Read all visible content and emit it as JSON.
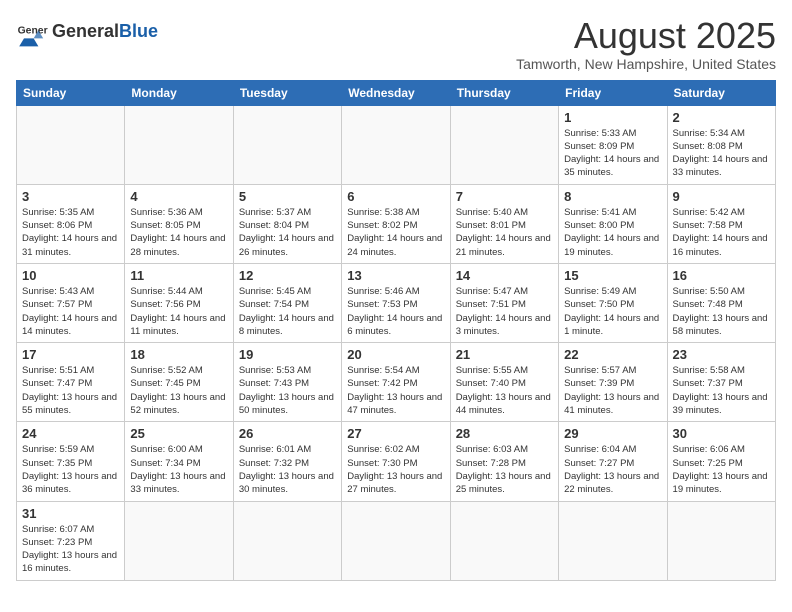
{
  "header": {
    "logo_general": "General",
    "logo_blue": "Blue",
    "month_year": "August 2025",
    "location": "Tamworth, New Hampshire, United States"
  },
  "days_of_week": [
    "Sunday",
    "Monday",
    "Tuesday",
    "Wednesday",
    "Thursday",
    "Friday",
    "Saturday"
  ],
  "weeks": [
    [
      {
        "day": "",
        "info": ""
      },
      {
        "day": "",
        "info": ""
      },
      {
        "day": "",
        "info": ""
      },
      {
        "day": "",
        "info": ""
      },
      {
        "day": "",
        "info": ""
      },
      {
        "day": "1",
        "info": "Sunrise: 5:33 AM\nSunset: 8:09 PM\nDaylight: 14 hours and 35 minutes."
      },
      {
        "day": "2",
        "info": "Sunrise: 5:34 AM\nSunset: 8:08 PM\nDaylight: 14 hours and 33 minutes."
      }
    ],
    [
      {
        "day": "3",
        "info": "Sunrise: 5:35 AM\nSunset: 8:06 PM\nDaylight: 14 hours and 31 minutes."
      },
      {
        "day": "4",
        "info": "Sunrise: 5:36 AM\nSunset: 8:05 PM\nDaylight: 14 hours and 28 minutes."
      },
      {
        "day": "5",
        "info": "Sunrise: 5:37 AM\nSunset: 8:04 PM\nDaylight: 14 hours and 26 minutes."
      },
      {
        "day": "6",
        "info": "Sunrise: 5:38 AM\nSunset: 8:02 PM\nDaylight: 14 hours and 24 minutes."
      },
      {
        "day": "7",
        "info": "Sunrise: 5:40 AM\nSunset: 8:01 PM\nDaylight: 14 hours and 21 minutes."
      },
      {
        "day": "8",
        "info": "Sunrise: 5:41 AM\nSunset: 8:00 PM\nDaylight: 14 hours and 19 minutes."
      },
      {
        "day": "9",
        "info": "Sunrise: 5:42 AM\nSunset: 7:58 PM\nDaylight: 14 hours and 16 minutes."
      }
    ],
    [
      {
        "day": "10",
        "info": "Sunrise: 5:43 AM\nSunset: 7:57 PM\nDaylight: 14 hours and 14 minutes."
      },
      {
        "day": "11",
        "info": "Sunrise: 5:44 AM\nSunset: 7:56 PM\nDaylight: 14 hours and 11 minutes."
      },
      {
        "day": "12",
        "info": "Sunrise: 5:45 AM\nSunset: 7:54 PM\nDaylight: 14 hours and 8 minutes."
      },
      {
        "day": "13",
        "info": "Sunrise: 5:46 AM\nSunset: 7:53 PM\nDaylight: 14 hours and 6 minutes."
      },
      {
        "day": "14",
        "info": "Sunrise: 5:47 AM\nSunset: 7:51 PM\nDaylight: 14 hours and 3 minutes."
      },
      {
        "day": "15",
        "info": "Sunrise: 5:49 AM\nSunset: 7:50 PM\nDaylight: 14 hours and 1 minute."
      },
      {
        "day": "16",
        "info": "Sunrise: 5:50 AM\nSunset: 7:48 PM\nDaylight: 13 hours and 58 minutes."
      }
    ],
    [
      {
        "day": "17",
        "info": "Sunrise: 5:51 AM\nSunset: 7:47 PM\nDaylight: 13 hours and 55 minutes."
      },
      {
        "day": "18",
        "info": "Sunrise: 5:52 AM\nSunset: 7:45 PM\nDaylight: 13 hours and 52 minutes."
      },
      {
        "day": "19",
        "info": "Sunrise: 5:53 AM\nSunset: 7:43 PM\nDaylight: 13 hours and 50 minutes."
      },
      {
        "day": "20",
        "info": "Sunrise: 5:54 AM\nSunset: 7:42 PM\nDaylight: 13 hours and 47 minutes."
      },
      {
        "day": "21",
        "info": "Sunrise: 5:55 AM\nSunset: 7:40 PM\nDaylight: 13 hours and 44 minutes."
      },
      {
        "day": "22",
        "info": "Sunrise: 5:57 AM\nSunset: 7:39 PM\nDaylight: 13 hours and 41 minutes."
      },
      {
        "day": "23",
        "info": "Sunrise: 5:58 AM\nSunset: 7:37 PM\nDaylight: 13 hours and 39 minutes."
      }
    ],
    [
      {
        "day": "24",
        "info": "Sunrise: 5:59 AM\nSunset: 7:35 PM\nDaylight: 13 hours and 36 minutes."
      },
      {
        "day": "25",
        "info": "Sunrise: 6:00 AM\nSunset: 7:34 PM\nDaylight: 13 hours and 33 minutes."
      },
      {
        "day": "26",
        "info": "Sunrise: 6:01 AM\nSunset: 7:32 PM\nDaylight: 13 hours and 30 minutes."
      },
      {
        "day": "27",
        "info": "Sunrise: 6:02 AM\nSunset: 7:30 PM\nDaylight: 13 hours and 27 minutes."
      },
      {
        "day": "28",
        "info": "Sunrise: 6:03 AM\nSunset: 7:28 PM\nDaylight: 13 hours and 25 minutes."
      },
      {
        "day": "29",
        "info": "Sunrise: 6:04 AM\nSunset: 7:27 PM\nDaylight: 13 hours and 22 minutes."
      },
      {
        "day": "30",
        "info": "Sunrise: 6:06 AM\nSunset: 7:25 PM\nDaylight: 13 hours and 19 minutes."
      }
    ],
    [
      {
        "day": "31",
        "info": "Sunrise: 6:07 AM\nSunset: 7:23 PM\nDaylight: 13 hours and 16 minutes."
      },
      {
        "day": "",
        "info": ""
      },
      {
        "day": "",
        "info": ""
      },
      {
        "day": "",
        "info": ""
      },
      {
        "day": "",
        "info": ""
      },
      {
        "day": "",
        "info": ""
      },
      {
        "day": "",
        "info": ""
      }
    ]
  ]
}
